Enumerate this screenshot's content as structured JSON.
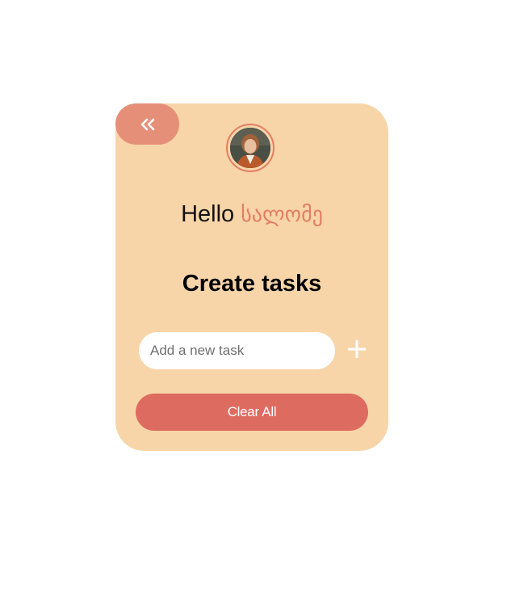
{
  "card": {
    "back_icon": "double-chevron-left-icon",
    "avatar_alt": "user-avatar",
    "greeting": {
      "hello": "Hello",
      "name": "სალომე"
    },
    "title": "Create tasks",
    "task_input": {
      "value": "",
      "placeholder": "Add a new task"
    },
    "add_icon": "plus-icon",
    "clear_label": "Clear All"
  },
  "colors": {
    "card_bg": "#f8d5a9",
    "back_button": "#e58f79",
    "accent": "#e27e64",
    "clear_button": "#de6b60"
  }
}
